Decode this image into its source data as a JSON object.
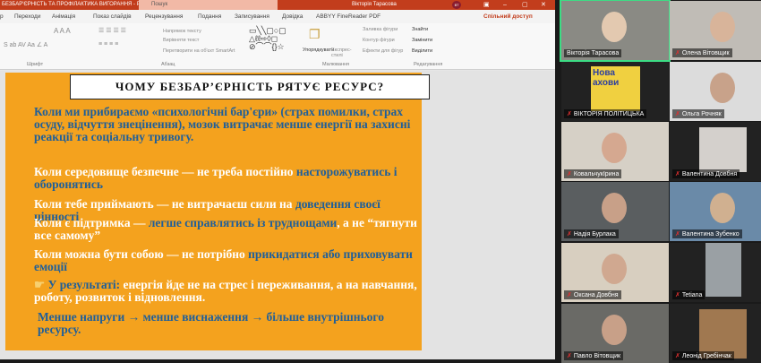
{
  "window": {
    "title": "БЕЗБАР'ЄРНІСТЬ ТА ПРОФІЛАКТИКА ВИГОРАННЯ - PowerPoint",
    "search_placeholder": "Пошук",
    "user": "Вікторія Тарасова",
    "user_initials": "ВТ"
  },
  "tabs": [
    "р",
    "Переходи",
    "Анімація",
    "Показ слайдів",
    "Рецензування",
    "Подання",
    "Записування",
    "Довідка",
    "ABBYY FineReader PDF"
  ],
  "share_label": "Спільний доступ",
  "ribbon": {
    "groups": [
      "Шрифт",
      "Абзац",
      "Малювання",
      "Редагування"
    ],
    "text_direction": "Напрямок тексту",
    "align_text": "Вирівняти текст",
    "smartart": "Перетворити на об'єкт SmartArt",
    "arrange": "Упорядкувати",
    "quick_styles": "Експрес-стилі",
    "shape_fill": "Заливка фігури",
    "shape_outline": "Контур фігури",
    "shape_effects": "Ефекти для фігур",
    "find": "Знайти",
    "replace": "Замінити",
    "select": "Виділити"
  },
  "slide": {
    "title": "ЧОМУ БЕЗБАР’ЄРНІСТЬ РЯТУЄ РЕСУРС?",
    "intro": "Коли ми прибираємо «психологічні бар'єри» (страх помилки, страх осуду, відчуття знецінення), мозок витрачає менше енергії на захисні реакції та соціальну тривогу.",
    "bullets": [
      {
        "a": "Коли середовище безпечне — не треба постійно ",
        "b": "насторожуватись і оборонятись"
      },
      {
        "a": "Коли тебе приймають — не витрачаєш сили на ",
        "b": "доведення своєї цінності"
      },
      {
        "a": "Коли є підтримка — ",
        "b": "легше справлятись із труднощами",
        "c": ", а не “тягнути все самому”"
      },
      {
        "a": "Коли можна бути собою — не потрібно ",
        "b": "прикидатися або приховувати емоції"
      }
    ],
    "result_icon": "pointing-hand-icon",
    "result_label": "У результаті:",
    "result_text": " енергія йде не на стрес і переживання, а на навчання, роботу, розвиток і відновлення.",
    "summary": "Менше напруги → менше виснаження → більше внутрішнього ресурсу."
  },
  "participants": [
    "Вікторія Тарасова",
    "Олена Вітовщик",
    "ВІКТОРІЯ ПОЛІТИЦЬКА",
    "Ольга Рочняк",
    "КовальчукІрина",
    "Валентина Довбня",
    "Надія Бурлака",
    "Валентина Зубенко",
    "Оксана Довбня",
    "Tetiana",
    "Павло Вітовщик",
    "Леонід Гребінчак"
  ],
  "colors": {
    "slide_bg": "#f4a21e",
    "accent_text": "#1f5f9a",
    "titlebar": "#c23d1c",
    "active_speaker": "#3ddc84"
  }
}
